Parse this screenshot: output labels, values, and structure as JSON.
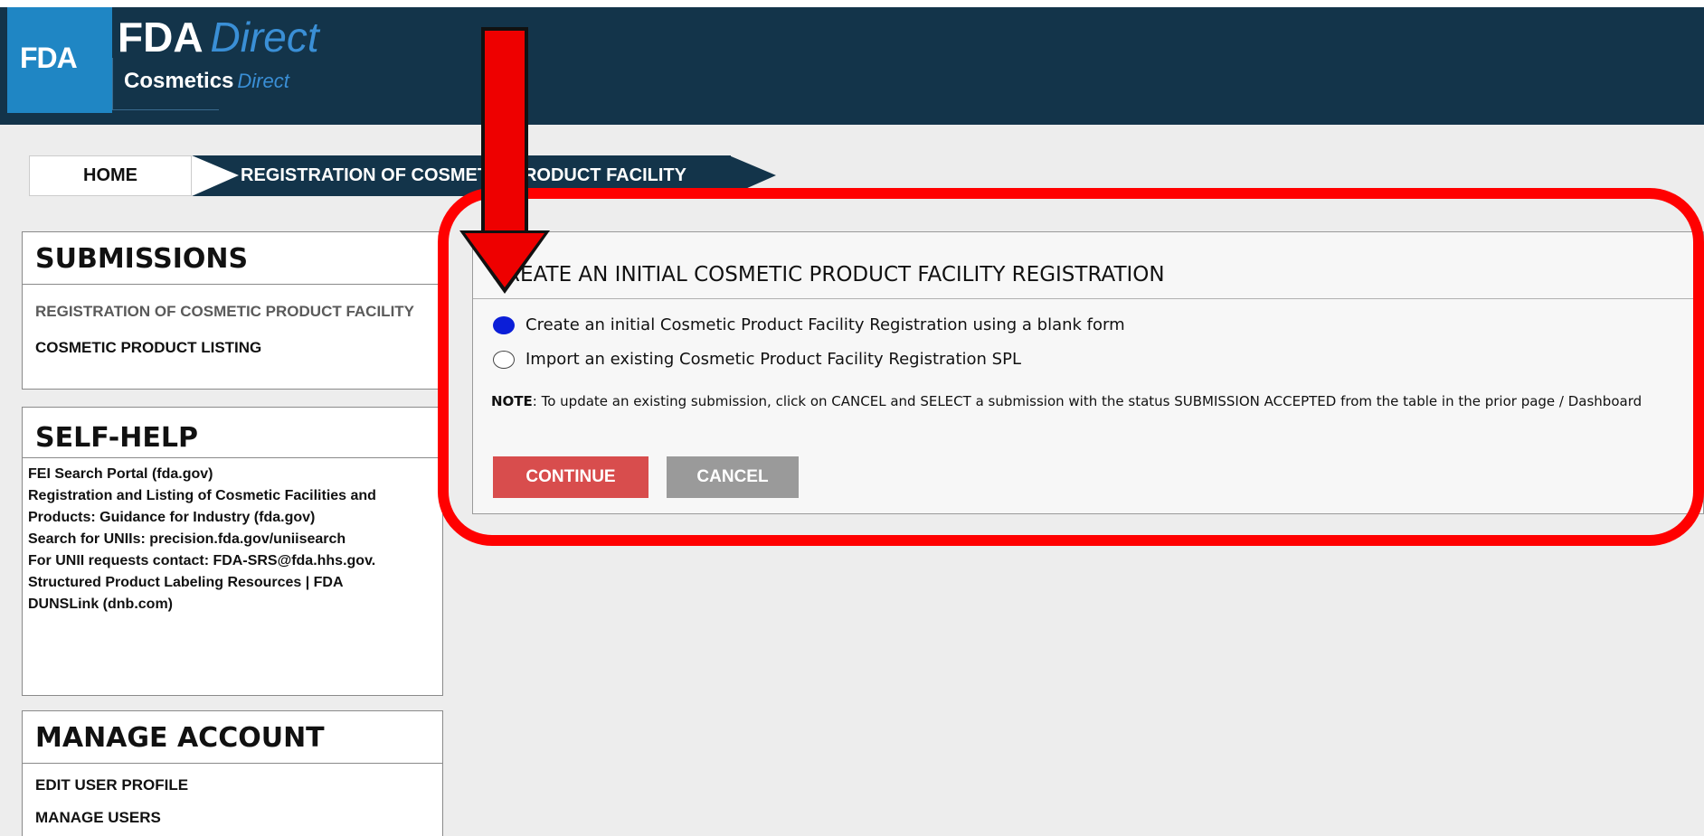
{
  "header": {
    "fda_badge": "FDA",
    "brand_main": "FDA",
    "brand_main_suffix": "Direct",
    "brand_sub": "Cosmetics",
    "brand_sub_suffix": "Direct"
  },
  "breadcrumb": {
    "home": "HOME",
    "current": "REGISTRATION OF COSMETIC PRODUCT FACILITY"
  },
  "sidebar": {
    "submissions": {
      "title": "SUBMISSIONS",
      "items": [
        {
          "label": "REGISTRATION OF COSMETIC PRODUCT FACILITY"
        },
        {
          "label": "COSMETIC PRODUCT LISTING"
        }
      ]
    },
    "self_help": {
      "title": "SELF-HELP",
      "links": [
        {
          "label": "FEI Search Portal (fda.gov)"
        },
        {
          "label": "Registration and Listing of Cosmetic Facilities and"
        },
        {
          "label": "Products: Guidance for Industry (fda.gov)"
        },
        {
          "label": "Search for UNIIs: precision.fda.gov/uniisearch"
        },
        {
          "label": "For UNII requests contact:  FDA-SRS@fda.hhs.gov."
        },
        {
          "label": "Structured Product Labeling Resources | FDA"
        },
        {
          "label": "DUNSLink (dnb.com)"
        }
      ]
    },
    "manage_account": {
      "title": "MANAGE ACCOUNT",
      "items": [
        {
          "label": "EDIT USER PROFILE"
        },
        {
          "label": "MANAGE USERS"
        }
      ]
    }
  },
  "panel": {
    "title": "CREATE AN INITIAL COSMETIC PRODUCT FACILITY REGISTRATION",
    "options": [
      {
        "label": "Create an initial Cosmetic Product Facility Registration using a blank form",
        "selected": true
      },
      {
        "label": "Import an existing Cosmetic Product Facility Registration SPL",
        "selected": false
      }
    ],
    "note_label": "NOTE",
    "note_text": ": To update an existing submission, click on CANCEL and SELECT a submission with the status SUBMISSION ACCEPTED from the table in the prior page / Dashboard",
    "continue_label": "CONTINUE",
    "cancel_label": "CANCEL"
  },
  "colors": {
    "header_bg": "#13344a",
    "accent_blue": "#1f86c4",
    "continue_btn": "#d84d4d",
    "cancel_btn": "#9a9a9a",
    "annotation_red": "#ff0000",
    "radio_selected": "#0b1ed8"
  }
}
